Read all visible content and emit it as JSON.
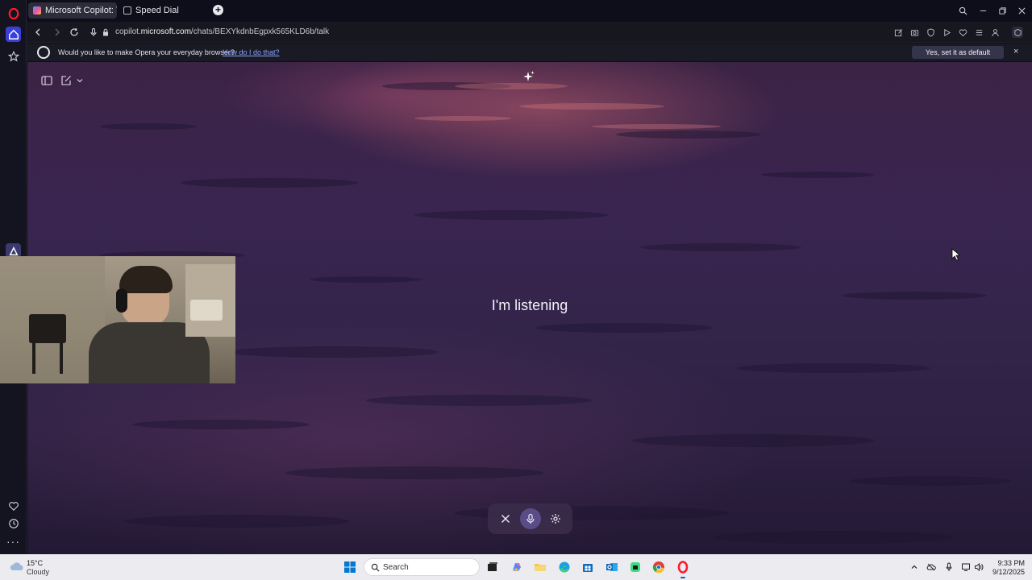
{
  "browser": {
    "tabs": [
      {
        "title": "Microsoft Copilot: Your AI",
        "active": true
      },
      {
        "title": "Speed Dial",
        "active": false
      }
    ],
    "new_tab_label": "+",
    "url_prefix": "copilot.",
    "url_domain": "microsoft.com",
    "url_path": "/chats/BEXYkdnbEgpxk565KLD6b/talk"
  },
  "default_browser_notice": {
    "text": "Would you like to make Opera your everyday browser?",
    "link": "How do I do that?",
    "button": "Yes, set it as default browser",
    "close": "×"
  },
  "copilot": {
    "status": "I'm listening",
    "background_accent": "#c4606e"
  },
  "sidebar": {
    "more_label": "···"
  },
  "taskbar": {
    "weather_temp": "15°C",
    "weather_desc": "Cloudy",
    "search_placeholder": "Search",
    "time": "9:33 PM",
    "date": "9/12/2025",
    "accent": "#0067c0"
  }
}
